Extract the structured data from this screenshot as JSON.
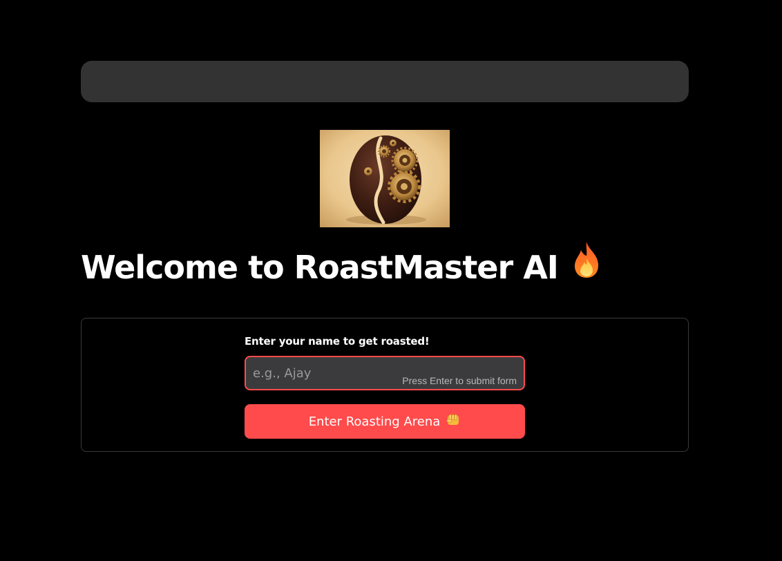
{
  "header": {
    "title": "Welcome to RoastMaster AI",
    "title_icon": "fire-icon",
    "logo_icon": "coffee-bean-gears-logo"
  },
  "form": {
    "label": "Enter your name to get roasted!",
    "name_input": {
      "placeholder": "e.g., Ajay",
      "value": "",
      "hint": "Press Enter to submit form"
    },
    "submit_label": "Enter Roasting Arena",
    "submit_icon": "fist-icon"
  },
  "colors": {
    "background": "#000000",
    "top_bar": "#333333",
    "accent": "#ff4b4b",
    "input_bg": "#3b3b3d",
    "border": "#3a3a3a"
  }
}
